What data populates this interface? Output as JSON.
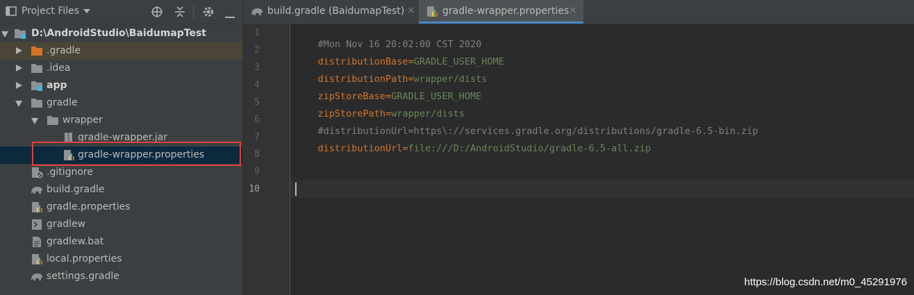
{
  "panel": {
    "title": "Project Files"
  },
  "tabs": [
    {
      "label": "build.gradle (BaidumapTest)",
      "close": "×",
      "icon": "gradle-elephant-icon",
      "active": false
    },
    {
      "label": "gradle-wrapper.properties",
      "close": "×",
      "icon": "properties-file-icon",
      "active": true
    }
  ],
  "tree": [
    {
      "label": "D:\\AndroidStudio\\BaidumapTest",
      "icon": "module-folder-icon",
      "expanded": true
    },
    {
      "label": ".gradle",
      "icon": "folder-orange-icon",
      "expanded": false
    },
    {
      "label": ".idea",
      "icon": "folder-icon",
      "expanded": false
    },
    {
      "label": "app",
      "icon": "module-folder-icon",
      "expanded": false
    },
    {
      "label": "gradle",
      "icon": "folder-icon",
      "expanded": true
    },
    {
      "label": "wrapper",
      "icon": "folder-icon",
      "expanded": true
    },
    {
      "label": "gradle-wrapper.jar",
      "icon": "jar-file-icon"
    },
    {
      "label": "gradle-wrapper.properties",
      "icon": "properties-file-icon"
    },
    {
      "label": ".gitignore",
      "icon": "ignore-file-icon"
    },
    {
      "label": "build.gradle",
      "icon": "gradle-elephant-icon"
    },
    {
      "label": "gradle.properties",
      "icon": "properties-file-icon"
    },
    {
      "label": "gradlew",
      "icon": "shell-script-icon"
    },
    {
      "label": "gradlew.bat",
      "icon": "text-file-icon"
    },
    {
      "label": "local.properties",
      "icon": "properties-file-icon"
    },
    {
      "label": "settings.gradle",
      "icon": "gradle-elephant-icon"
    }
  ],
  "editor": {
    "line_numbers": [
      "1",
      "2",
      "3",
      "4",
      "5",
      "6",
      "7",
      "8",
      "9",
      "10"
    ],
    "lines": [
      {
        "comment": "#Mon Nov 16 20:02:00 CST 2020"
      },
      {
        "key": "distributionBase",
        "eq": "=",
        "value": "GRADLE_USER_HOME"
      },
      {
        "key": "distributionPath",
        "eq": "=",
        "value": "wrapper/dists"
      },
      {
        "key": "zipStoreBase",
        "eq": "=",
        "value": "GRADLE_USER_HOME"
      },
      {
        "key": "zipStorePath",
        "eq": "=",
        "value": "wrapper/dists"
      },
      {
        "comment": "#distributionUrl=https\\://services.gradle.org/distributions/gradle-6.5-bin.zip"
      },
      {
        "key": "distributionUrl",
        "eq": "=",
        "value": "file:///D:/AndroidStudio/gradle-6.5-all.zip"
      }
    ],
    "current_line": "10"
  },
  "watermark": "https://blog.csdn.net/m0_45291976",
  "colors": {
    "key": "#cc7832",
    "value": "#6a8759",
    "comment": "#808080",
    "selection": "#0d293e",
    "highlight_box": "#e0413c"
  }
}
